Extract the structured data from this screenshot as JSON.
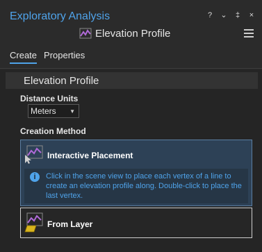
{
  "window": {
    "title": "Exploratory Analysis",
    "controls": [
      "?",
      "⌄",
      "‡",
      "×"
    ]
  },
  "header": {
    "title": "Elevation Profile",
    "icon": "elevation-profile-icon"
  },
  "tabs": [
    {
      "label": "Create",
      "active": true
    },
    {
      "label": "Properties",
      "active": false
    }
  ],
  "section": {
    "title": "Elevation Profile"
  },
  "distance_units": {
    "label": "Distance Units",
    "value": "Meters"
  },
  "creation_method": {
    "label": "Creation Method",
    "options": [
      {
        "label": "Interactive Placement",
        "selected": true,
        "info": "Click in the scene view to place each vertex of a line to create an elevation profile along.  Double-click to place the last vertex."
      },
      {
        "label": "From Layer",
        "selected": false
      }
    ]
  },
  "colors": {
    "accent": "#4fa3ea",
    "selected_bg": "#2d4156",
    "icon_purple": "#7b4ea3",
    "layer_yellow": "#d9b51e"
  }
}
